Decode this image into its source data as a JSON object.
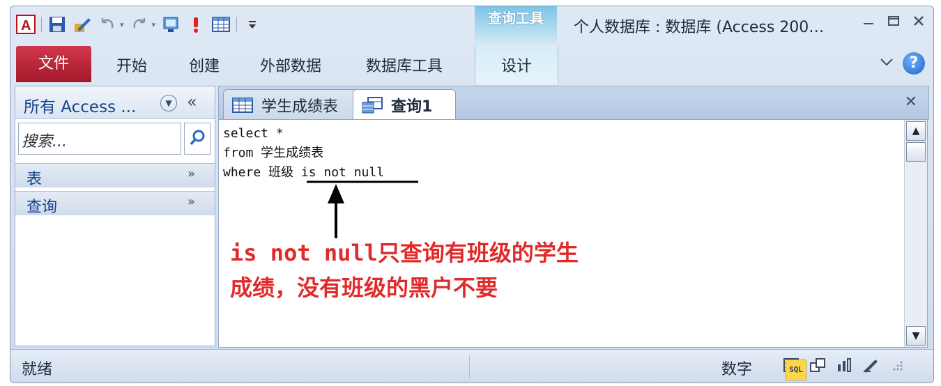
{
  "titlebar": {
    "context_group": "查询工具",
    "window_title": "个人数据库 : 数据库 (Access 200…"
  },
  "ribbon": {
    "file_tab": "文件",
    "tabs": [
      "开始",
      "创建",
      "外部数据",
      "数据库工具"
    ],
    "context_tab": "设计"
  },
  "nav": {
    "title": "所有 Access ...",
    "search_placeholder": "搜索...",
    "groups": [
      {
        "label": "表"
      },
      {
        "label": "查询"
      }
    ]
  },
  "document": {
    "tabs": [
      {
        "label": "学生成绩表"
      },
      {
        "label": "查询1"
      }
    ],
    "sql_lines": [
      "select *",
      "from 学生成绩表",
      "where 班级 is not null"
    ],
    "annotation_line1": "is not null只查询有班级的学生",
    "annotation_line2": "成绩，没有班级的黑户不要"
  },
  "statusbar": {
    "left": "就绪",
    "mode": "数字",
    "sql_view_label": "SQL"
  },
  "colors": {
    "file_tab": "#b3223a",
    "annotation": "#e12a2a",
    "context_tab": "#7ec4e6",
    "help": "#1d63c9"
  }
}
